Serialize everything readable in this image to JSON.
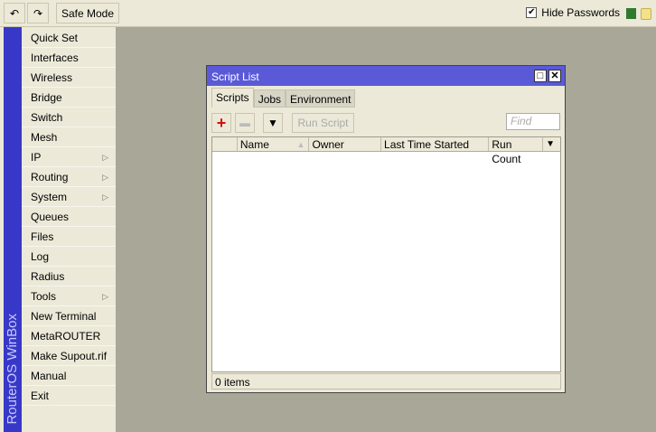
{
  "toolbar": {
    "undo": "undo-icon",
    "redo": "redo-icon",
    "safe_mode": "Safe Mode",
    "hide_passwords": "Hide Passwords",
    "hide_passwords_checked": true
  },
  "sidebar": {
    "brand": "RouterOS WinBox",
    "items": [
      {
        "label": "Quick Set"
      },
      {
        "label": "Interfaces"
      },
      {
        "label": "Wireless"
      },
      {
        "label": "Bridge"
      },
      {
        "label": "Switch"
      },
      {
        "label": "Mesh"
      },
      {
        "label": "IP",
        "submenu": true
      },
      {
        "label": "Routing",
        "submenu": true
      },
      {
        "label": "System",
        "submenu": true
      },
      {
        "label": "Queues"
      },
      {
        "label": "Files"
      },
      {
        "label": "Log"
      },
      {
        "label": "Radius"
      },
      {
        "label": "Tools",
        "submenu": true
      },
      {
        "label": "New Terminal"
      },
      {
        "label": "MetaROUTER"
      },
      {
        "label": "Make Supout.rif"
      },
      {
        "label": "Manual"
      },
      {
        "label": "Exit"
      }
    ]
  },
  "window": {
    "title": "Script List",
    "tabs": [
      "Scripts",
      "Jobs",
      "Environment"
    ],
    "run_script": "Run Script",
    "find_placeholder": "Find",
    "columns": [
      "Name",
      "Owner",
      "Last Time Started",
      "Run Count"
    ],
    "status": "0 items"
  }
}
